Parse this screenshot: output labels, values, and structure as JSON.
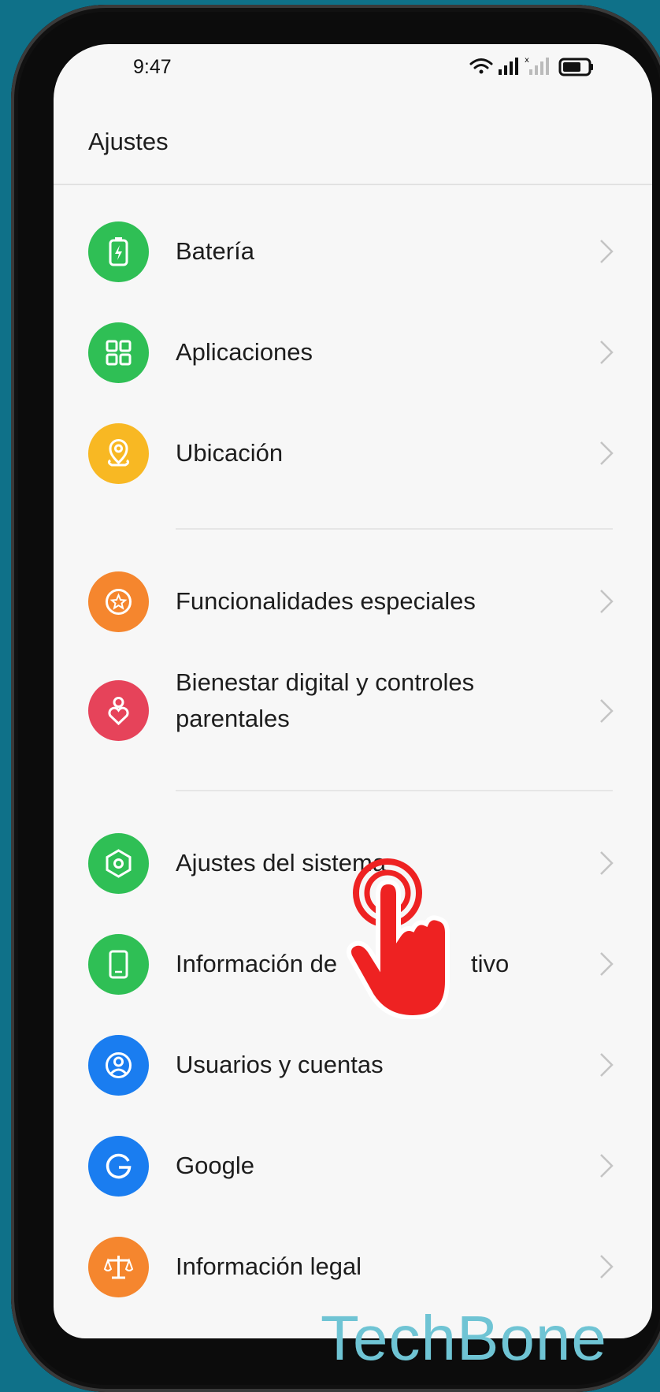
{
  "status_bar": {
    "time": "9:47"
  },
  "header": {
    "title": "Ajustes"
  },
  "items": [
    {
      "label": "Batería",
      "icon": "battery-icon",
      "color": "#2fbf55"
    },
    {
      "label": "Aplicaciones",
      "icon": "apps-grid-icon",
      "color": "#2fbf55"
    },
    {
      "label": "Ubicación",
      "icon": "location-pin-icon",
      "color": "#f8b823"
    },
    {
      "label": "Funcionalidades especiales",
      "icon": "star-circle-icon",
      "color": "#f5862e"
    },
    {
      "label_line1": "Bienestar digital y controles",
      "label_line2": "parentales",
      "icon": "wellbeing-heart-icon",
      "color": "#e6435a"
    },
    {
      "label": "Ajustes del sistema",
      "icon": "system-hexagon-icon",
      "color": "#2fbf55"
    },
    {
      "label": "Información del dispositivo",
      "label_visible": "Información de",
      "label_tail": "tivo",
      "icon": "device-phone-icon",
      "color": "#2fbf55"
    },
    {
      "label": "Usuarios y cuentas",
      "icon": "user-circle-icon",
      "color": "#1a7df0"
    },
    {
      "label": "Google",
      "icon": "google-g-icon",
      "color": "#1a7df0"
    },
    {
      "label": "Información legal",
      "icon": "legal-scale-icon",
      "color": "#f5862e"
    }
  ],
  "overlay": {
    "watermark": "TechBone",
    "tap_hand_color": "#ee2222"
  }
}
